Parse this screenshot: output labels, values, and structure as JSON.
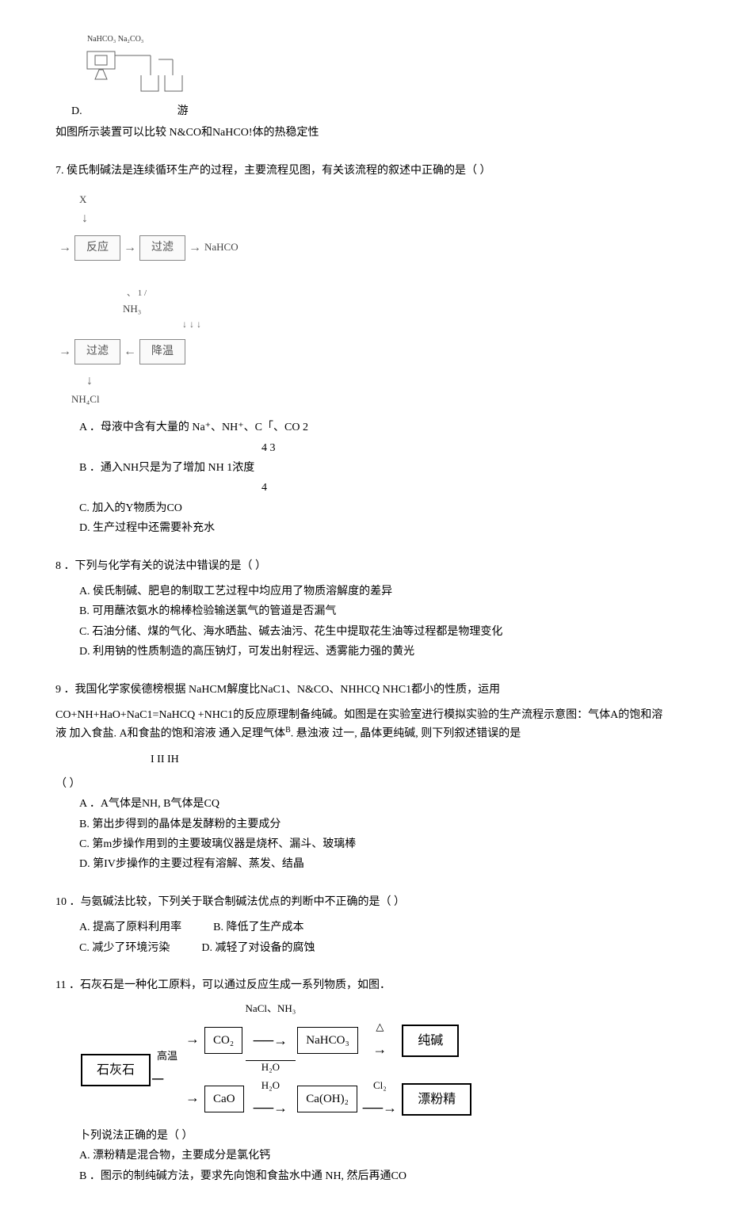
{
  "item_d": {
    "label": "D.",
    "desc": "如图所示装置可以比较 N&CO和NaHCO!体的热稳定性",
    "apparatus_label": "NaHCO₃ Na₂CO₃",
    "apparatus_side": "游"
  },
  "q7": {
    "stem": "7. 侯氏制碱法是连续循环生产的过程，主要流程见图，有关该流程的叙述中正确的是（            ）",
    "diagram": {
      "x": "X",
      "box1": "反应",
      "box2": "过滤",
      "out1": "NaHCO",
      "nh3": "NH₃",
      "box3": "过滤",
      "box4": "降温",
      "out2": "NH₄Cl"
    },
    "optA": "A ．母液中含有大量的 Na⁺、NH⁺、C「、CO 2",
    "optA_sub": "4              3",
    "optB": "B ．通入NH只是为了增加 NH 1浓度",
    "optB_sub": "4",
    "optC": "C. 加入的Y物质为CO",
    "optD": "D. 生产过程中还需要补充水"
  },
  "q8": {
    "stem": "8 ．下列与化学有关的说法中错误的是（         ）",
    "optA": "A. 侯氏制碱、肥皂的制取工艺过程中均应用了物质溶解度的差异",
    "optB": "B. 可用蘸浓氨水的棉棒检验输送氯气的管道是否漏气",
    "optC": "C. 石油分储、煤的气化、海水晒盐、碱去油污、花生中提取花生油等过程都是物理变化",
    "optD": "D. 利用钠的性质制造的高压钠灯，可发出射程远、透雾能力强的黄光"
  },
  "q9": {
    "stem1": "9 ．我国化学家侯德榜根据    NaHCM解度比NaC1、N&CO、NHHCQ NHC1都小的性质，运用",
    "stem2": "CO+NH+HaO+NaC1=NaHCQ +NHC1的反应原理制备纯碱。如图是在实验室进行模拟实验的生产流程示意图：气体A的饱和溶液 加入食盐. A和食盐的饱和溶液 通入足理气体",
    "stem2b": ". 悬浊液 过一, 晶体更纯碱, 则下列叙述错误的是",
    "sub_b": "B",
    "roman_line": "I                      II           IH",
    "paren": "（ ）",
    "optA": "A ．A气体是NH, B气体是CQ",
    "optB": "B. 第出步得到的晶体是发酵粉的主要成分",
    "optC": "C. 第m步操作用到的主要玻璃仪器是烧杯、漏斗、玻璃棒",
    "optD": "D. 第IV步操作的主要过程有溶解、蒸发、结晶"
  },
  "q10": {
    "stem": "10 ．与氨碱法比较，下列关于联合制碱法优点的判断中不正确的是（            ）",
    "optA": "A. 提高了原料利用率",
    "optB": "B. 降低了生产成本",
    "optC": "C. 减少了环境污染",
    "optD": "D. 减轻了对设备的腐蚀"
  },
  "q11": {
    "stem": "11 ．石灰石是一种化工原料，可以通过反应生成一系列物质，如图．",
    "diagram": {
      "limestone": "石灰石",
      "heat": "高温",
      "co2": "CO₂",
      "cao": "CaO",
      "top_reagents": "NaCl、NH₃",
      "h2o": "H₂O",
      "nahco3": "NaHCO₃",
      "delta": "△",
      "soda": "纯碱",
      "caoh2": "Ca(OH)₂",
      "cl2": "Cl₂",
      "bleach": "漂粉精"
    },
    "sub_stem": "卜列说法正确的是（      ）",
    "optA": "A. 漂粉精是混合物，主要成分是氯化钙",
    "optB": "B ．图示的制纯碱方法，要求先向饱和食盐水中通        NH, 然后再通CO"
  }
}
